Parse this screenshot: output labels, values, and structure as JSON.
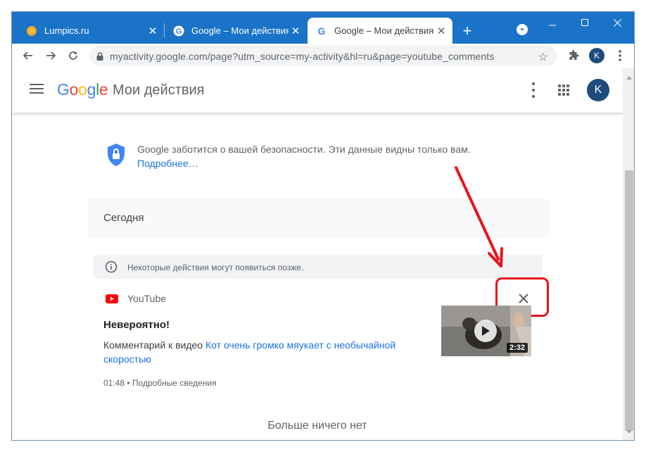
{
  "browser": {
    "tabs": [
      {
        "title": "Lumpics.ru",
        "icon": "lumpics-favicon"
      },
      {
        "title": "Google – Мои действия",
        "icon": "google-favicon"
      },
      {
        "title": "Google – Мои действия",
        "icon": "google-favicon",
        "active": true
      }
    ],
    "new_tab": "+",
    "url": "myactivity.google.com/page?utm_source=my-activity&hl=ru&page=youtube_comments",
    "profile_initial": "K"
  },
  "app": {
    "logo": {
      "g1": "G",
      "g2": "o",
      "g3": "o",
      "g4": "g",
      "g5": "l",
      "g6": "e"
    },
    "title": "Мои действия",
    "avatar_initial": "K"
  },
  "privacy": {
    "text": "Google заботится о вашей безопасности. Эти данные видны только вам.",
    "link": "Подробнее…"
  },
  "section": {
    "label": "Сегодня"
  },
  "notice": {
    "text": "Некоторые действия могут появиться позже."
  },
  "entry": {
    "product": "YouTube",
    "title": "Невероятно!",
    "desc_prefix": "Комментарий к видео ",
    "video_title": "Кот очень громко мяукает с необычайной скоростью",
    "duration": "2:32",
    "time": "01:48",
    "separator": " • ",
    "details_link": "Подробные сведения"
  },
  "footer": {
    "no_more": "Больше ничего нет"
  },
  "colors": {
    "annotation": "#e8141b",
    "titlebar": "#1a73c7",
    "link": "#1a73e8"
  }
}
